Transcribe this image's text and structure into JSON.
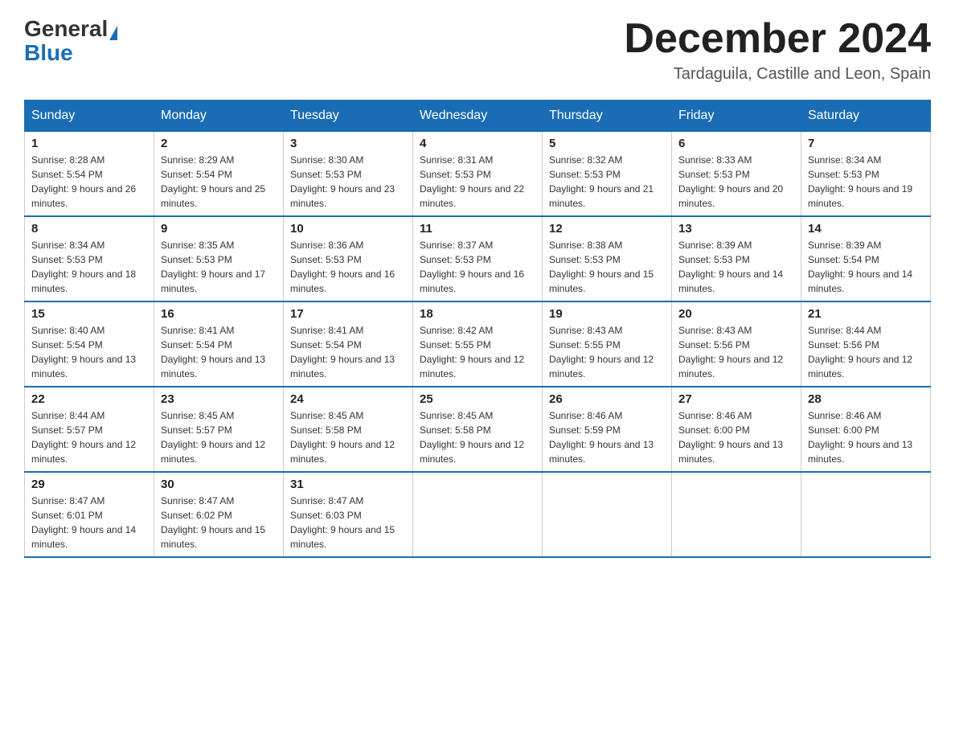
{
  "header": {
    "logo_general": "General",
    "logo_blue": "Blue",
    "month_title": "December 2024",
    "location": "Tardaguila, Castille and Leon, Spain"
  },
  "days_of_week": [
    "Sunday",
    "Monday",
    "Tuesday",
    "Wednesday",
    "Thursday",
    "Friday",
    "Saturday"
  ],
  "weeks": [
    [
      {
        "day": "1",
        "sunrise": "8:28 AM",
        "sunset": "5:54 PM",
        "daylight": "9 hours and 26 minutes."
      },
      {
        "day": "2",
        "sunrise": "8:29 AM",
        "sunset": "5:54 PM",
        "daylight": "9 hours and 25 minutes."
      },
      {
        "day": "3",
        "sunrise": "8:30 AM",
        "sunset": "5:53 PM",
        "daylight": "9 hours and 23 minutes."
      },
      {
        "day": "4",
        "sunrise": "8:31 AM",
        "sunset": "5:53 PM",
        "daylight": "9 hours and 22 minutes."
      },
      {
        "day": "5",
        "sunrise": "8:32 AM",
        "sunset": "5:53 PM",
        "daylight": "9 hours and 21 minutes."
      },
      {
        "day": "6",
        "sunrise": "8:33 AM",
        "sunset": "5:53 PM",
        "daylight": "9 hours and 20 minutes."
      },
      {
        "day": "7",
        "sunrise": "8:34 AM",
        "sunset": "5:53 PM",
        "daylight": "9 hours and 19 minutes."
      }
    ],
    [
      {
        "day": "8",
        "sunrise": "8:34 AM",
        "sunset": "5:53 PM",
        "daylight": "9 hours and 18 minutes."
      },
      {
        "day": "9",
        "sunrise": "8:35 AM",
        "sunset": "5:53 PM",
        "daylight": "9 hours and 17 minutes."
      },
      {
        "day": "10",
        "sunrise": "8:36 AM",
        "sunset": "5:53 PM",
        "daylight": "9 hours and 16 minutes."
      },
      {
        "day": "11",
        "sunrise": "8:37 AM",
        "sunset": "5:53 PM",
        "daylight": "9 hours and 16 minutes."
      },
      {
        "day": "12",
        "sunrise": "8:38 AM",
        "sunset": "5:53 PM",
        "daylight": "9 hours and 15 minutes."
      },
      {
        "day": "13",
        "sunrise": "8:39 AM",
        "sunset": "5:53 PM",
        "daylight": "9 hours and 14 minutes."
      },
      {
        "day": "14",
        "sunrise": "8:39 AM",
        "sunset": "5:54 PM",
        "daylight": "9 hours and 14 minutes."
      }
    ],
    [
      {
        "day": "15",
        "sunrise": "8:40 AM",
        "sunset": "5:54 PM",
        "daylight": "9 hours and 13 minutes."
      },
      {
        "day": "16",
        "sunrise": "8:41 AM",
        "sunset": "5:54 PM",
        "daylight": "9 hours and 13 minutes."
      },
      {
        "day": "17",
        "sunrise": "8:41 AM",
        "sunset": "5:54 PM",
        "daylight": "9 hours and 13 minutes."
      },
      {
        "day": "18",
        "sunrise": "8:42 AM",
        "sunset": "5:55 PM",
        "daylight": "9 hours and 12 minutes."
      },
      {
        "day": "19",
        "sunrise": "8:43 AM",
        "sunset": "5:55 PM",
        "daylight": "9 hours and 12 minutes."
      },
      {
        "day": "20",
        "sunrise": "8:43 AM",
        "sunset": "5:56 PM",
        "daylight": "9 hours and 12 minutes."
      },
      {
        "day": "21",
        "sunrise": "8:44 AM",
        "sunset": "5:56 PM",
        "daylight": "9 hours and 12 minutes."
      }
    ],
    [
      {
        "day": "22",
        "sunrise": "8:44 AM",
        "sunset": "5:57 PM",
        "daylight": "9 hours and 12 minutes."
      },
      {
        "day": "23",
        "sunrise": "8:45 AM",
        "sunset": "5:57 PM",
        "daylight": "9 hours and 12 minutes."
      },
      {
        "day": "24",
        "sunrise": "8:45 AM",
        "sunset": "5:58 PM",
        "daylight": "9 hours and 12 minutes."
      },
      {
        "day": "25",
        "sunrise": "8:45 AM",
        "sunset": "5:58 PM",
        "daylight": "9 hours and 12 minutes."
      },
      {
        "day": "26",
        "sunrise": "8:46 AM",
        "sunset": "5:59 PM",
        "daylight": "9 hours and 13 minutes."
      },
      {
        "day": "27",
        "sunrise": "8:46 AM",
        "sunset": "6:00 PM",
        "daylight": "9 hours and 13 minutes."
      },
      {
        "day": "28",
        "sunrise": "8:46 AM",
        "sunset": "6:00 PM",
        "daylight": "9 hours and 13 minutes."
      }
    ],
    [
      {
        "day": "29",
        "sunrise": "8:47 AM",
        "sunset": "6:01 PM",
        "daylight": "9 hours and 14 minutes."
      },
      {
        "day": "30",
        "sunrise": "8:47 AM",
        "sunset": "6:02 PM",
        "daylight": "9 hours and 15 minutes."
      },
      {
        "day": "31",
        "sunrise": "8:47 AM",
        "sunset": "6:03 PM",
        "daylight": "9 hours and 15 minutes."
      },
      null,
      null,
      null,
      null
    ]
  ]
}
